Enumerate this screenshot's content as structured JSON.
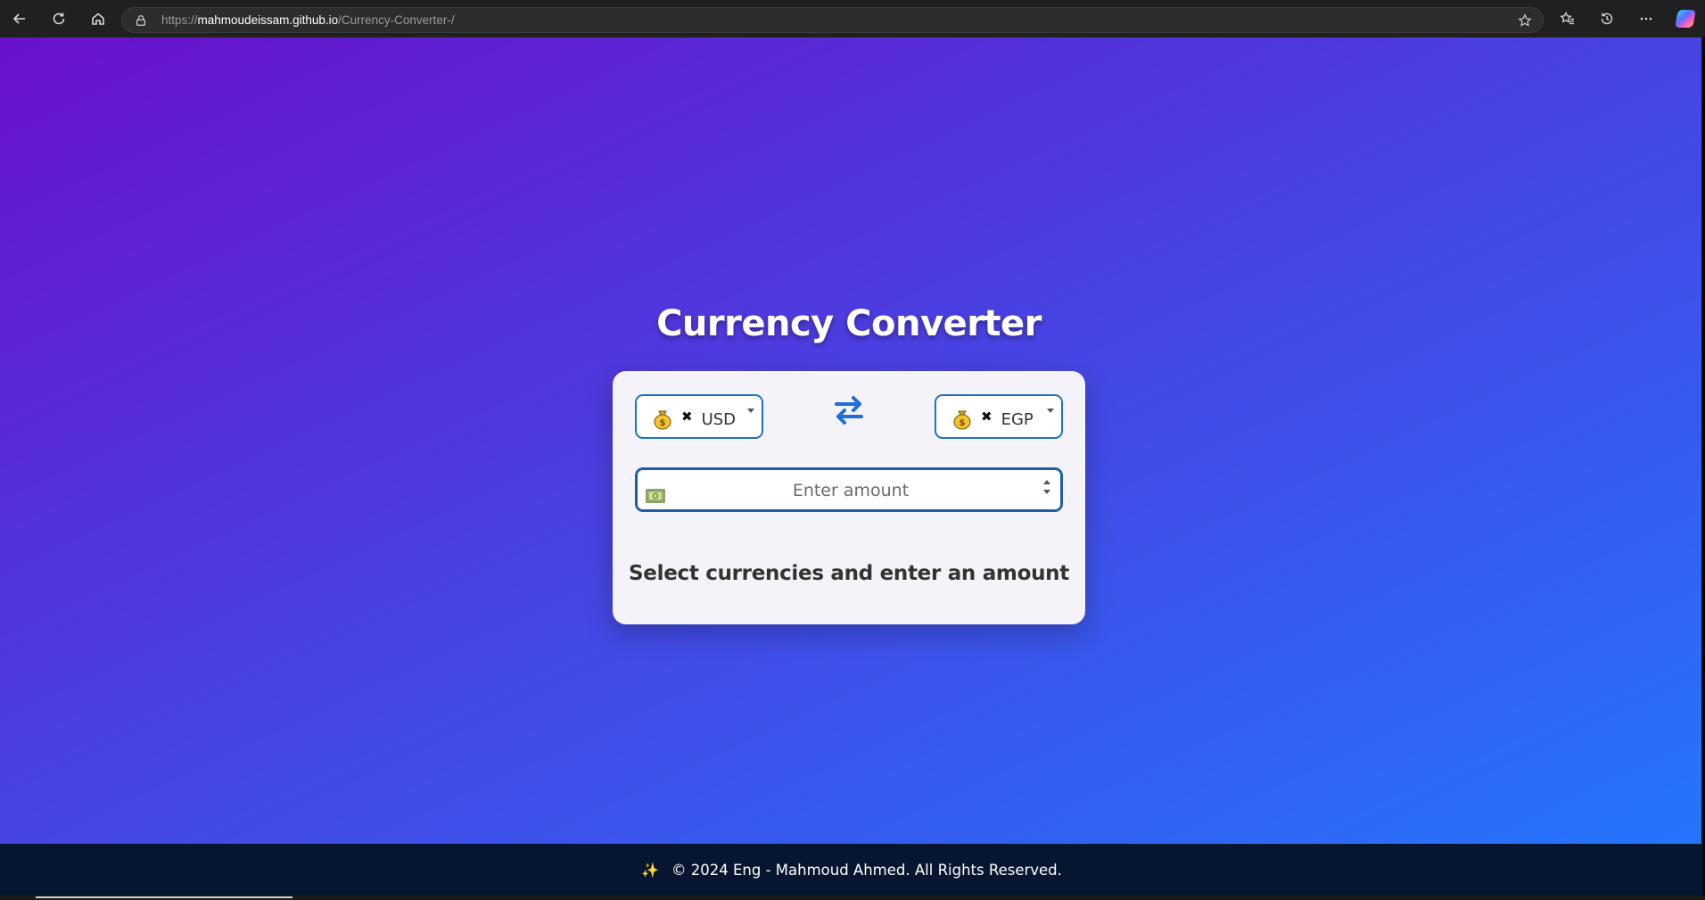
{
  "browser": {
    "url_scheme": "https://",
    "url_host": "mahmoudeissam.github.io",
    "url_path": "/Currency-Converter-/"
  },
  "page": {
    "title": "Currency Converter",
    "from_currency": {
      "code": "USD",
      "flag_icon": "money-bag-icon"
    },
    "to_currency": {
      "code": "EGP",
      "flag_icon": "money-bag-icon"
    },
    "amount": {
      "value": "",
      "placeholder": "Enter amount"
    },
    "result_text": "Select currencies and enter an amount",
    "accent_color": "#1e73c8"
  },
  "footer": {
    "text": "© 2024 Eng - Mahmoud Ahmed. All Rights Reserved."
  }
}
